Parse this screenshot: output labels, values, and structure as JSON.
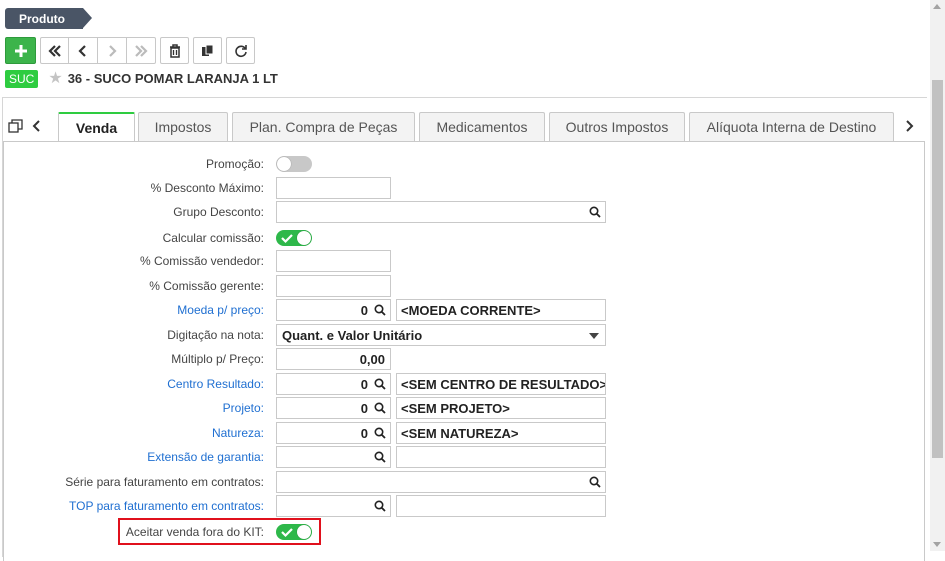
{
  "breadcrumb": {
    "label": "Produto"
  },
  "product": {
    "badge": "SUC",
    "title": "36 - SUCO POMAR LARANJA 1 LT"
  },
  "tabs": [
    {
      "label": "Venda"
    },
    {
      "label": "Impostos"
    },
    {
      "label": "Plan. Compra de Peças"
    },
    {
      "label": "Medicamentos"
    },
    {
      "label": "Outros Impostos"
    },
    {
      "label": "Alíquota Interna de Destino"
    }
  ],
  "form": {
    "promocao": {
      "label": "Promoção:",
      "on": false
    },
    "desconto_maximo": {
      "label": "% Desconto Máximo:",
      "value": ""
    },
    "grupo_desconto": {
      "label": "Grupo Desconto:",
      "value": ""
    },
    "calcular_comissao": {
      "label": "Calcular comissão:",
      "on": true
    },
    "comissao_vendedor": {
      "label": "% Comissão vendedor:",
      "value": ""
    },
    "comissao_gerente": {
      "label": "% Comissão gerente:",
      "value": ""
    },
    "moeda": {
      "label": "Moeda p/ preço:",
      "code": "0",
      "desc": "<MOEDA CORRENTE>"
    },
    "digitacao": {
      "label": "Digitação na nota:",
      "value": "Quant. e Valor Unitário"
    },
    "multiplo": {
      "label": "Múltiplo p/ Preço:",
      "value": "0,00"
    },
    "centro_resultado": {
      "label": "Centro Resultado:",
      "code": "0",
      "desc": "<SEM CENTRO DE RESULTADO>"
    },
    "projeto": {
      "label": "Projeto:",
      "code": "0",
      "desc": "<SEM PROJETO>"
    },
    "natureza": {
      "label": "Natureza:",
      "code": "0",
      "desc": "<SEM NATUREZA>"
    },
    "extensao_garantia": {
      "label": "Extensão de garantia:",
      "code": "",
      "desc": ""
    },
    "serie_faturamento": {
      "label": "Série para faturamento em contratos:",
      "value": ""
    },
    "top_faturamento": {
      "label": "TOP para faturamento em contratos:",
      "code": "",
      "desc": ""
    },
    "aceitar_venda_kit": {
      "label": "Aceitar venda fora do KIT:",
      "on": true
    }
  },
  "colors": {
    "accent": "#2ecc40",
    "link": "#1f6fd1",
    "highlight": "#e0101c"
  }
}
